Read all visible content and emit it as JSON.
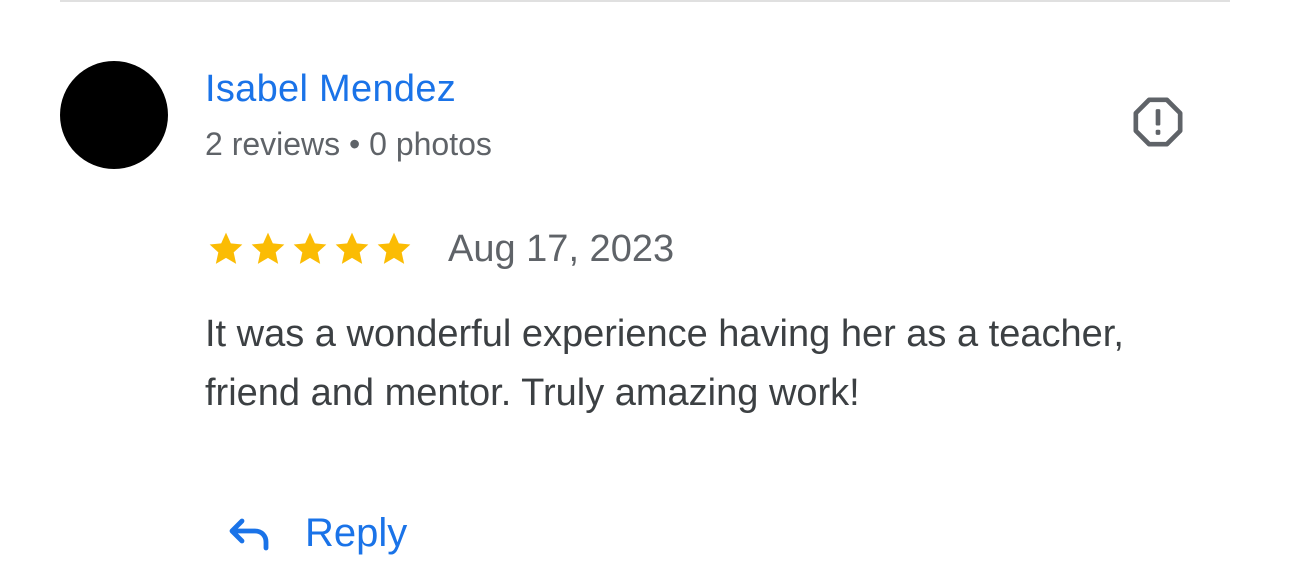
{
  "review": {
    "reviewer": {
      "name": "Isabel Mendez",
      "meta": "2 reviews • 0 photos"
    },
    "rating": 5,
    "rating_max": 5,
    "date": "Aug 17, 2023",
    "text": "It was a wonderful experience having her as a teacher, friend and mentor. Truly amazing work!"
  },
  "actions": {
    "reply_label": "Reply",
    "reply_icon": "reply-arrow-icon",
    "report_icon": "report-octagon-icon"
  },
  "colors": {
    "link_blue": "#1a73e8",
    "star_gold": "#fbbc04",
    "secondary_text": "#5f6368",
    "body_text": "#3c4043"
  }
}
